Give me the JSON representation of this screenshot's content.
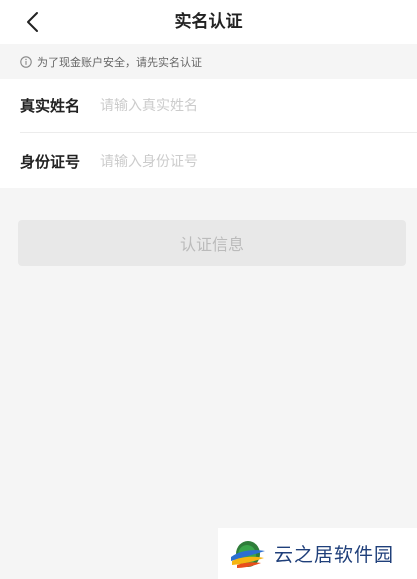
{
  "header": {
    "title": "实名认证",
    "back_icon": "chevron-left-icon"
  },
  "notice": {
    "icon": "info-circle-icon",
    "text": "为了现金账户安全，请先实名认证"
  },
  "form": {
    "name_field": {
      "label": "真实姓名",
      "placeholder": "请输入真实姓名",
      "value": ""
    },
    "id_field": {
      "label": "身份证号",
      "placeholder": "请输入身份证号",
      "value": ""
    }
  },
  "submit": {
    "label": "认证信息"
  },
  "watermark": {
    "text": "云之居软件园"
  },
  "colors": {
    "background": "#f5f5f5",
    "surface": "#ffffff",
    "button_disabled": "#e8e8e8",
    "watermark_text": "#1f3f7a"
  }
}
